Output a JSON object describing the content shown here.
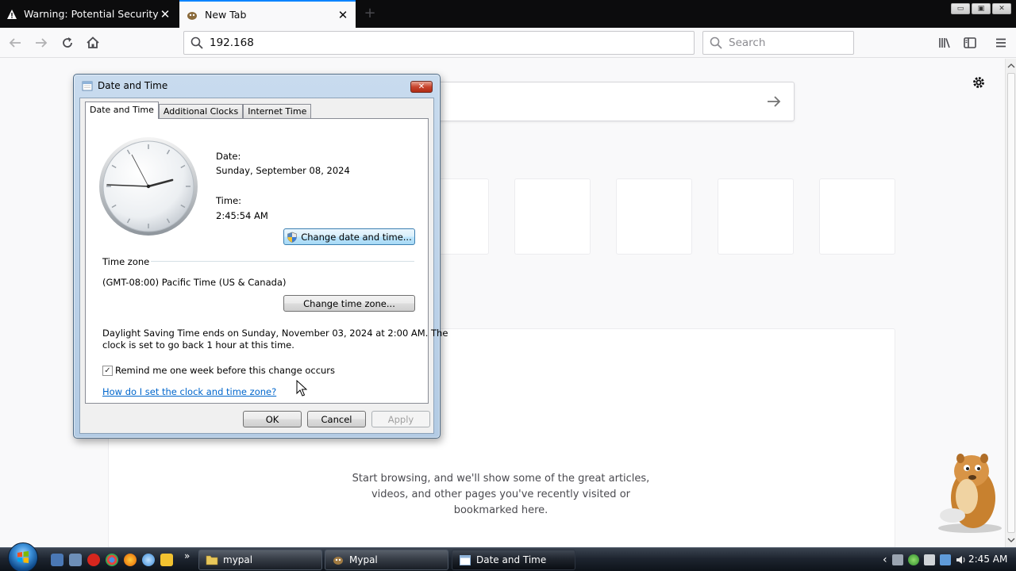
{
  "browser": {
    "tabs": [
      {
        "title": "Warning: Potential Security Risk Ahead",
        "close": "✕"
      },
      {
        "title": "New Tab",
        "close": "✕"
      }
    ],
    "new_tab_symbol": "+",
    "window_controls": [
      "▭",
      "▣",
      "✕"
    ],
    "url": "192.168",
    "search_placeholder": "Search"
  },
  "newtab": {
    "empty_message": "Start browsing, and we'll show some of the great articles, videos, and other pages you've recently visited or bookmarked here."
  },
  "dialog": {
    "title": "Date and Time",
    "close": "✕",
    "tabs": [
      "Date and Time",
      "Additional Clocks",
      "Internet Time"
    ],
    "date_label": "Date:",
    "date_value": "Sunday, September 08, 2024",
    "time_label": "Time:",
    "time_value": "2:45:54 AM",
    "change_date_button": "Change date and time...",
    "timezone_heading": "Time zone",
    "timezone_value": "(GMT-08:00) Pacific Time (US & Canada)",
    "change_timezone_button": "Change time zone...",
    "dst_line1": "Daylight Saving Time ends on Sunday, November 03, 2024 at 2:00 AM. The",
    "dst_line2": "clock is set to go back 1 hour at this time.",
    "remind_checked": true,
    "remind_label": "Remind me one week before this change occurs",
    "help_link": "How do I set the clock and time zone?",
    "ok": "OK",
    "cancel": "Cancel",
    "apply": "Apply"
  },
  "taskbar": {
    "overflow": "»",
    "buttons": [
      "mypal",
      "Mypal",
      "Date and Time"
    ],
    "tray_expand": "‹",
    "clock": "2:45 AM"
  },
  "colors": {
    "accent": "#0a84ff",
    "link": "#0066cc",
    "tabstrip": "#0c0c0d"
  }
}
